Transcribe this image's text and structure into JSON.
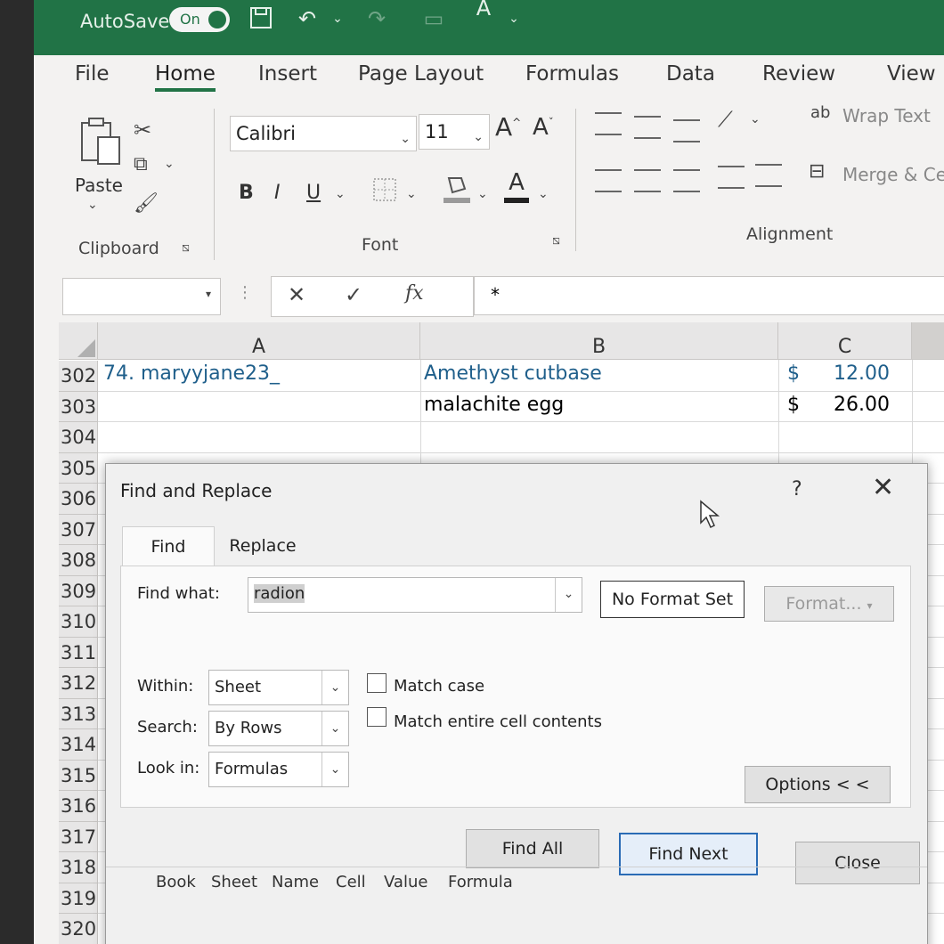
{
  "titlebar": {
    "autosave_label": "AutoSave",
    "autosave_state": "On",
    "font_color_letter": "A"
  },
  "menu": {
    "tabs": [
      "File",
      "Home",
      "Insert",
      "Page Layout",
      "Formulas",
      "Data",
      "Review",
      "View"
    ],
    "active": "Home"
  },
  "ribbon": {
    "clipboard": {
      "paste_label": "Paste",
      "group_label": "Clipboard"
    },
    "font": {
      "font_name": "Calibri",
      "font_size": "11",
      "grow_label": "A",
      "shrink_label": "A",
      "bold": "B",
      "italic": "I",
      "underline": "U",
      "font_color_letter": "A",
      "group_label": "Font"
    },
    "alignment": {
      "wrap_text": "Wrap Text",
      "merge_center": "Merge & Ce",
      "group_label": "Alignment"
    }
  },
  "formula_bar": {
    "cancel_glyph": "✕",
    "enter_glyph": "✓",
    "fx_label": "fx",
    "content": "*"
  },
  "sheet": {
    "columns": [
      "A",
      "B",
      "C"
    ],
    "rows": [
      {
        "num": "302",
        "a": "74. maryyjane23_",
        "b": "Amethyst cutbase",
        "currency": "$",
        "c": "12.00"
      },
      {
        "num": "303",
        "a": "",
        "b": "malachite egg",
        "currency": "$",
        "c": "26.00"
      },
      {
        "num": "304"
      },
      {
        "num": "305"
      },
      {
        "num": "306"
      },
      {
        "num": "307"
      },
      {
        "num": "308"
      },
      {
        "num": "309"
      },
      {
        "num": "310"
      },
      {
        "num": "311"
      },
      {
        "num": "312"
      },
      {
        "num": "313"
      },
      {
        "num": "314"
      },
      {
        "num": "315"
      },
      {
        "num": "316"
      },
      {
        "num": "317"
      },
      {
        "num": "318"
      },
      {
        "num": "319"
      },
      {
        "num": "320"
      }
    ]
  },
  "dialog": {
    "title": "Find and Replace",
    "help": "?",
    "close_glyph": "✕",
    "tabs": [
      "Find",
      "Replace"
    ],
    "find_what_label": "Find what:",
    "find_what_value": "radion",
    "no_format_set": "No Format Set",
    "format_button": "Format...",
    "within_label": "Within:",
    "within_value": "Sheet",
    "search_label": "Search:",
    "search_value": "By Rows",
    "look_in_label": "Look in:",
    "look_in_value": "Formulas",
    "match_case": "Match case",
    "match_entire": "Match entire cell contents",
    "options_button": "Options < <",
    "find_all": "Find All",
    "find_next": "Find Next",
    "close_button": "Close",
    "result_headers": [
      "Book",
      "Sheet",
      "Name",
      "Cell",
      "Value",
      "Formula"
    ]
  },
  "colors": {
    "excel_green": "#217346",
    "link_blue": "#1f5f8b",
    "primary_border": "#2a6bb5"
  }
}
